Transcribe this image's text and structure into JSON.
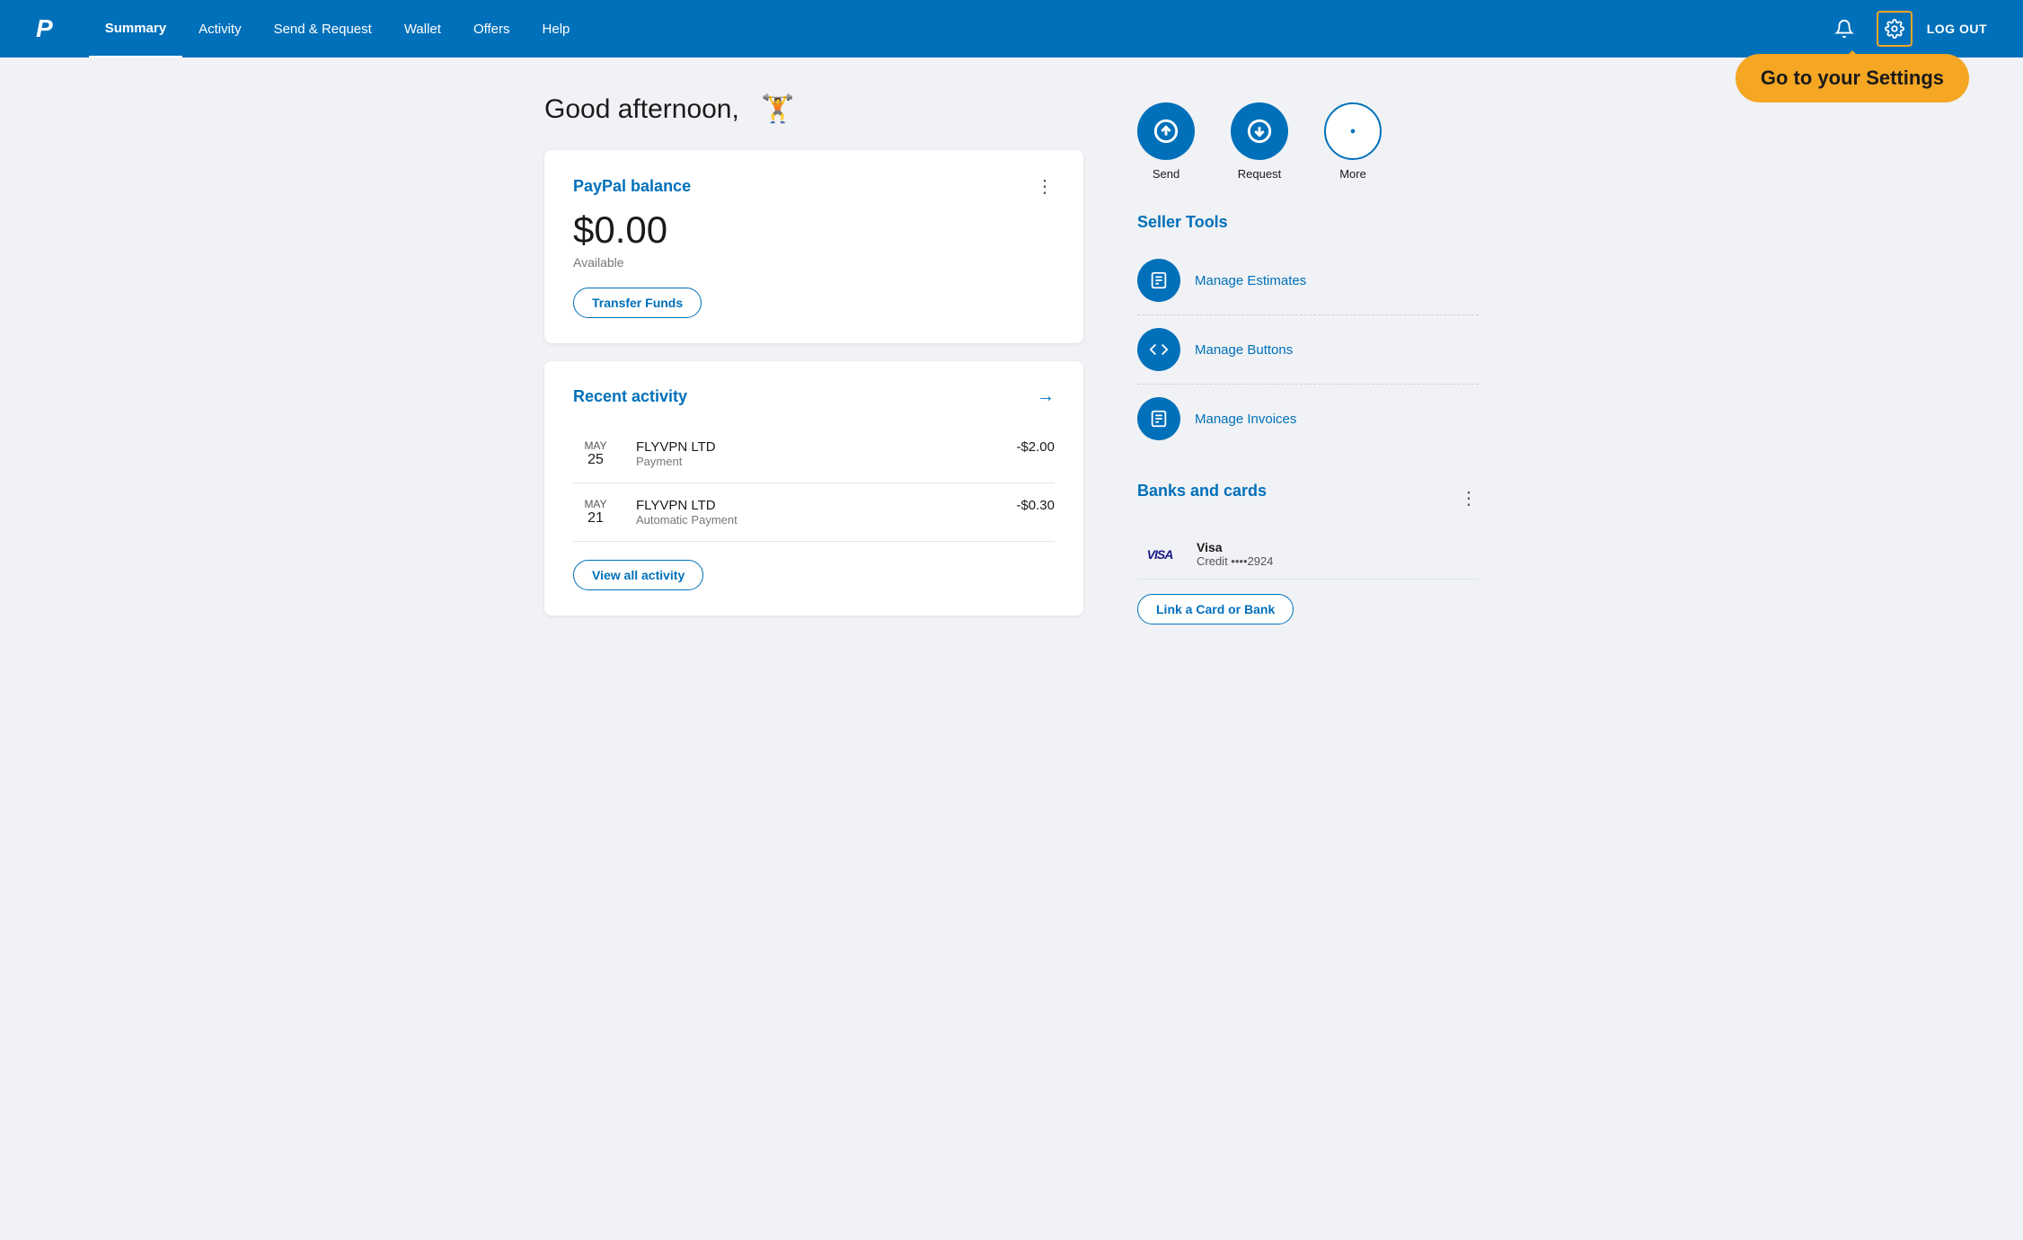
{
  "navbar": {
    "logo": "P",
    "links": [
      {
        "label": "Summary",
        "active": true
      },
      {
        "label": "Activity",
        "active": false
      },
      {
        "label": "Send & Request",
        "active": false
      },
      {
        "label": "Wallet",
        "active": false
      },
      {
        "label": "Offers",
        "active": false
      },
      {
        "label": "Help",
        "active": false
      }
    ],
    "logout_label": "LOG OUT"
  },
  "tooltip": {
    "text": "Go to your Settings"
  },
  "greeting": {
    "prefix": "Good afternoon,",
    "name": "🏋"
  },
  "balance_card": {
    "title": "PayPal balance",
    "amount": "$0.00",
    "available": "Available",
    "transfer_btn": "Transfer Funds"
  },
  "recent_activity": {
    "title": "Recent activity",
    "items": [
      {
        "month": "MAY",
        "day": "25",
        "merchant": "FLYVPN LTD",
        "type": "Payment",
        "amount": "-$2.00"
      },
      {
        "month": "MAY",
        "day": "21",
        "merchant": "FLYVPN LTD",
        "type": "Automatic Payment",
        "amount": "-$0.30"
      }
    ],
    "view_all_btn": "View all activity"
  },
  "actions": [
    {
      "label": "Send",
      "icon": "↑"
    },
    {
      "label": "Request",
      "icon": "↓"
    },
    {
      "label": "More",
      "icon": "•"
    }
  ],
  "seller_tools": {
    "title": "Seller Tools",
    "items": [
      {
        "label": "Manage Estimates",
        "icon": "≡"
      },
      {
        "label": "Manage Buttons",
        "icon": "</>"
      },
      {
        "label": "Manage Invoices",
        "icon": "≡"
      }
    ]
  },
  "banks_cards": {
    "title": "Banks and cards",
    "visa": {
      "logo": "VISA",
      "name": "Visa",
      "credit": "Credit ••••2924"
    },
    "link_btn": "Link a Card or Bank"
  }
}
